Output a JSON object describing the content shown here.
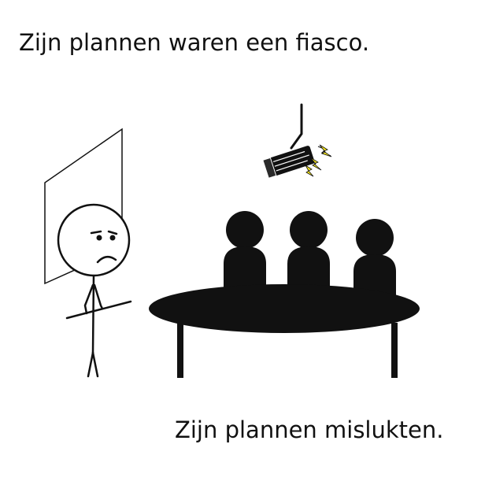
{
  "captions": {
    "top": "Zijn plannen waren een fiasco.",
    "bottom": "Zijn plannen mislukten."
  },
  "colors": {
    "ink": "#111111",
    "lightning": "#f5e51c",
    "background": "#ffffff"
  },
  "illustration": {
    "icons": [
      "stick-figure-presenter-icon",
      "presentation-board-icon",
      "projector-sparking-icon",
      "meeting-table-icon",
      "audience-person-icon"
    ],
    "audience_count": 3,
    "presenter_mood": "sad"
  }
}
